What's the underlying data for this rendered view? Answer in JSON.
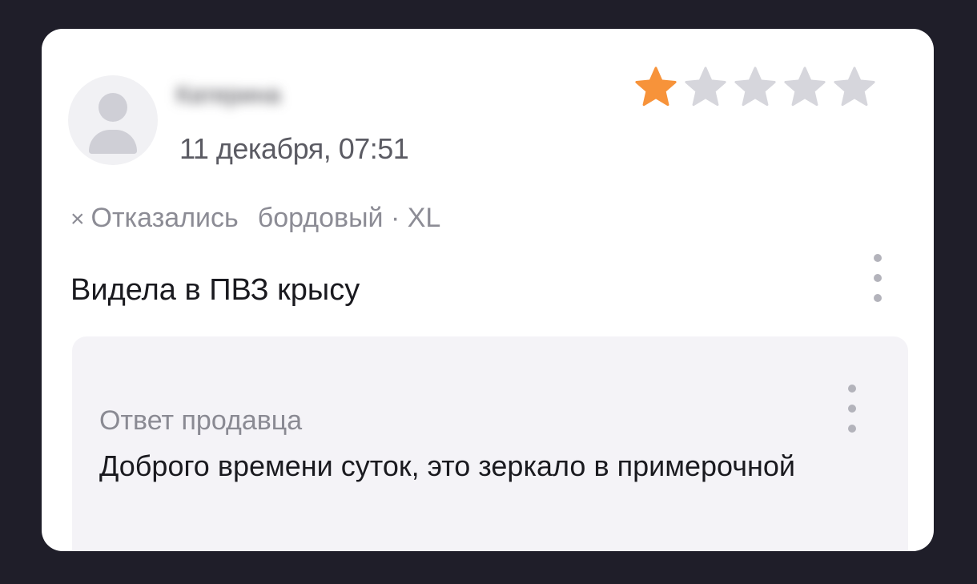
{
  "review": {
    "author": "Катерина",
    "date": "11 декабря, 07:51",
    "rating": 1,
    "rating_max": 5,
    "variant": {
      "status": "Отказались",
      "color": "бордовый",
      "separator": "·",
      "size": "XL"
    },
    "text": "Видела в ПВЗ крысу"
  },
  "reply": {
    "label": "Ответ продавца",
    "text": "Доброго времени суток, это зеркало в примерочной"
  },
  "icons": {
    "refused": "×",
    "star": "star-icon",
    "more": "more-vertical-icon"
  },
  "colors": {
    "star_active": "#f7933a",
    "star_inactive": "#d6d6dc",
    "background": "#1f1e29"
  }
}
